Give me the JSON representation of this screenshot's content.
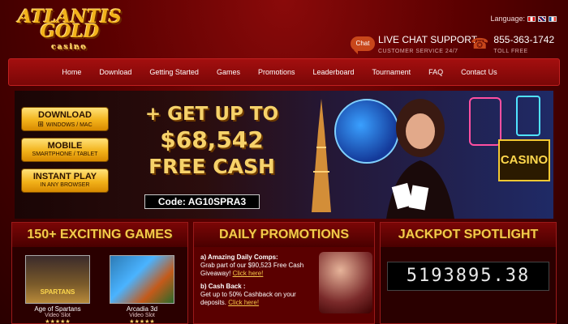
{
  "header": {
    "logo_line1": "ATLANTIS",
    "logo_line2": "GOLD",
    "logo_sub": "casino",
    "language_label": "Language:",
    "chat_icon_label": "Chat",
    "chat_title": "LIVE CHAT SUPPORT",
    "chat_sub": "CUSTOMER SERVICE 24/7",
    "phone_number": "855-363-1742",
    "phone_sub": "TOLL FREE"
  },
  "nav": {
    "items": [
      "Home",
      "Download",
      "Getting Started",
      "Games",
      "Promotions",
      "Leaderboard",
      "Tournament",
      "FAQ",
      "Contact Us"
    ]
  },
  "hero": {
    "buttons": [
      {
        "title": "DOWNLOAD",
        "sub": "WINDOWS / MAC"
      },
      {
        "title": "MOBILE",
        "sub": "SMARTPHONE / TABLET"
      },
      {
        "title": "INSTANT PLAY",
        "sub": "IN ANY BROWSER"
      }
    ],
    "headline_line1": "+ GET UP TO",
    "headline_line2": "$68,542",
    "headline_line3": "FREE CASH",
    "code": "Code: AG10SPRA3",
    "sign_text": "CASINO"
  },
  "games_panel": {
    "title": "150+ EXCITING GAMES",
    "games": [
      {
        "name": "Age of Spartans",
        "type": "Video Slot",
        "thumb_label": "SPARTANS",
        "stars": "★★★★★"
      },
      {
        "name": "Arcadia 3d",
        "type": "Video Slot",
        "thumb_label": "",
        "stars": "★★★★★"
      }
    ]
  },
  "promotions_panel": {
    "title": "DAILY PROMOTIONS",
    "items": [
      {
        "head": "a) Amazing Daily Comps:",
        "text": "Grab part of our $90,523 Free Cash Giveaway!",
        "link": "Click here!"
      },
      {
        "head": "b) Cash Back :",
        "text": "Get up to 50% Cashback on your deposits.",
        "link": "Click here!"
      }
    ]
  },
  "jackpot_panel": {
    "title": "JACKPOT SPOTLIGHT",
    "amount": "5193895.38"
  }
}
